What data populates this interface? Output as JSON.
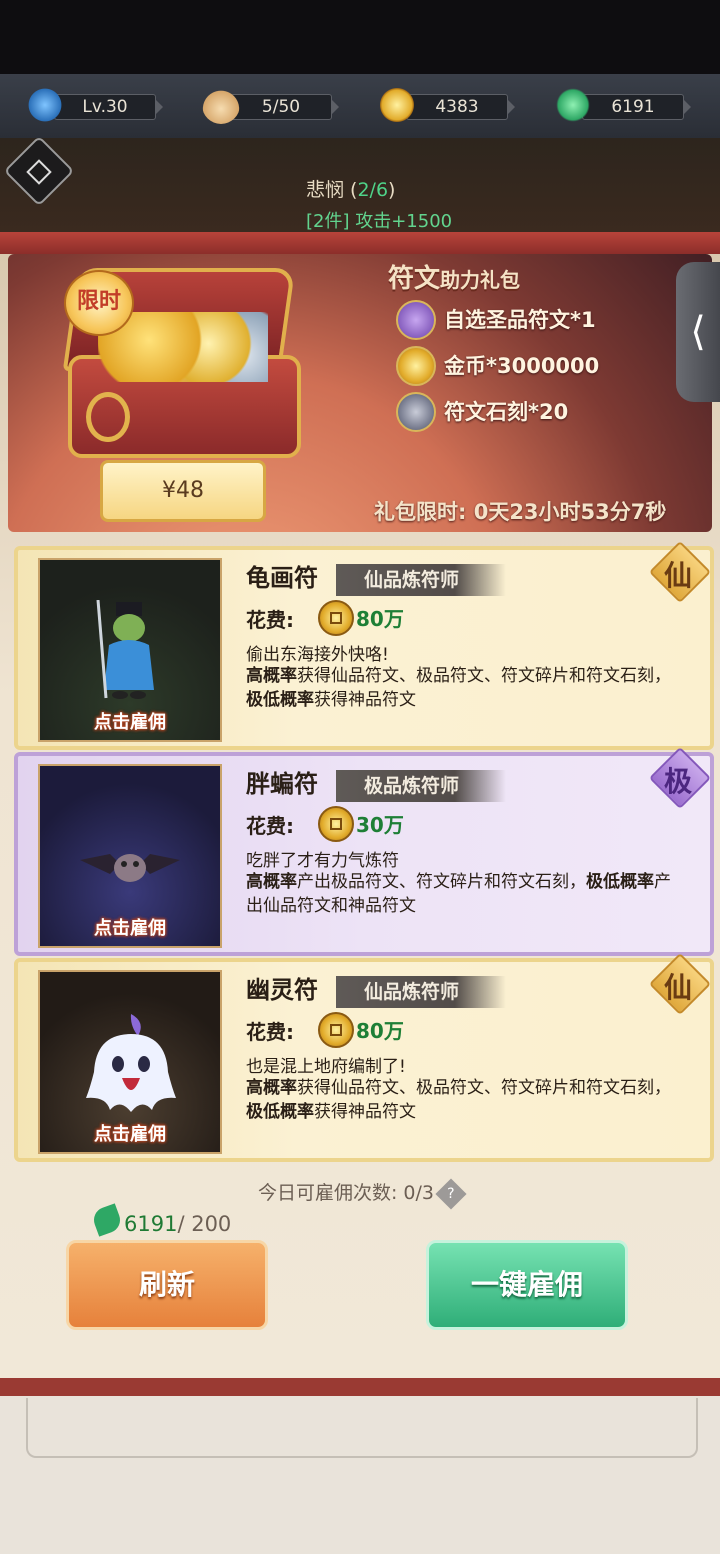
{
  "resources": [
    {
      "icon": "level-icon",
      "value": "Lv.30"
    },
    {
      "icon": "bun-icon",
      "value": "5/50"
    },
    {
      "icon": "coin-icon",
      "value": "4383"
    },
    {
      "icon": "leaf-icon",
      "value": "6191"
    }
  ],
  "set_info": {
    "name_prefix": "悲悯 (",
    "progress": "2/6",
    "name_suffix": ")",
    "bonus": "[2件] 攻击+1500"
  },
  "banner": {
    "limited_label": "限时",
    "title_main": "符文",
    "title_sub": "助力礼包",
    "price": "¥48",
    "items": [
      {
        "icon": "rune-select-icon",
        "label": "自选圣品符文*1"
      },
      {
        "icon": "coin-icon",
        "label": "金币*3000000"
      },
      {
        "icon": "rune-stone-icon",
        "label": "符文石刻*20"
      }
    ],
    "countdown": "礼包限时: 0天23小时53分7秒"
  },
  "cards": [
    {
      "name": "龟画符",
      "rank": "仙品炼符师",
      "badge": "仙",
      "cost_label": "花费:",
      "cost_value": "80万",
      "desc": "偷出东海接外快咯!",
      "detail_b1": "高概率",
      "detail_t1": "获得仙品符文、极品符文、符文碎片和符文石刻，",
      "detail_b2": "极低概率",
      "detail_t2": "获得神品符文",
      "hire": "点击雇佣"
    },
    {
      "name": "胖蝙符",
      "rank": "极品炼符师",
      "badge": "极",
      "cost_label": "花费:",
      "cost_value": "30万",
      "desc": "吃胖了才有力气炼符",
      "detail_b1": "高概率",
      "detail_t1": "产出极品符文、符文碎片和符文石刻，",
      "detail_b2": "极低概率",
      "detail_t2": "产出仙品符文和神品符文",
      "hire": "点击雇佣"
    },
    {
      "name": "幽灵符",
      "rank": "仙品炼符师",
      "badge": "仙",
      "cost_label": "花费:",
      "cost_value": "80万",
      "desc": "也是混上地府编制了!",
      "detail_b1": "高概率",
      "detail_t1": "获得仙品符文、极品符文、符文碎片和符文石刻，",
      "detail_b2": "极低概率",
      "detail_t2": "获得神品符文",
      "hire": "点击雇佣"
    }
  ],
  "hire_count": "今日可雇佣次数: 0/3",
  "leaf_cost": {
    "have": "6191",
    "need": "/ 200"
  },
  "buttons": {
    "refresh": "刷新",
    "hire_all": "一键雇佣"
  }
}
